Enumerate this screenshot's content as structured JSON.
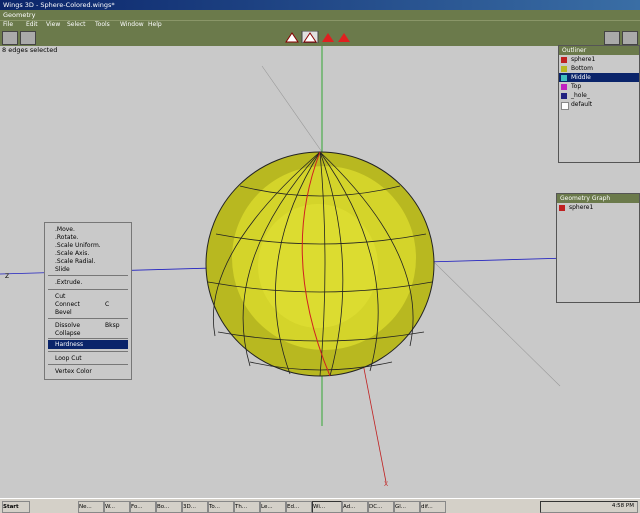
{
  "window": {
    "title": "Wings 3D - Sphere-Colored.wings*"
  },
  "menubar": {
    "title": "Geometry"
  },
  "menus": [
    "File",
    "Edit",
    "View",
    "Select",
    "Tools",
    "Window",
    "Help"
  ],
  "status": "8 edges selected",
  "outliner": {
    "title": "Outliner",
    "items": [
      "sphere1",
      "Bottom",
      "Middle",
      "Top",
      "_hole_",
      "default"
    ]
  },
  "geograph": {
    "title": "Geometry Graph",
    "item": "sphere1"
  },
  "context_menu": {
    "items": [
      ".Move.",
      ".Rotate.",
      ".Scale Uniform.",
      ".Scale Axis.",
      ".Scale Radial.",
      "Slide",
      ".Extrude.",
      "Cut",
      "Connect",
      "Bevel",
      "Dissolve",
      "Collapse",
      "Hardness",
      "Loop Cut",
      "Vertex Color"
    ],
    "shortcuts": {
      "connect": "C",
      "dissolve": "Bksp"
    },
    "selected": "Hardness"
  },
  "axis_label_z": "Z",
  "axis_label_x": "X",
  "taskbar": {
    "start": "Start",
    "tasks": [
      "Ne...",
      "W...",
      "Fo...",
      "Bo...",
      "3D...",
      "To...",
      "Th...",
      "Le...",
      "Ed...",
      "Wi...",
      "Ad...",
      "DC...",
      "Gl...",
      "dif..."
    ],
    "clock": "4:58 PM"
  }
}
